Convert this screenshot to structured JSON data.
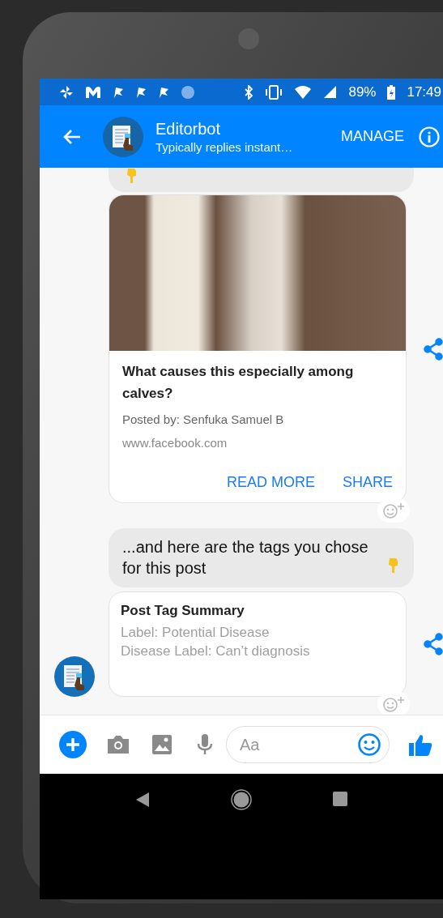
{
  "status_bar": {
    "battery": "89%",
    "time": "17:49"
  },
  "header": {
    "title": "Editorbot",
    "subtitle": "Typically replies instant…",
    "action": "MANAGE"
  },
  "messages": [
    {
      "kind": "emoji_tail"
    },
    {
      "kind": "link_card",
      "title": "What causes this especially among calves?",
      "posted_by": "Posted by: Senfuka Samuel B",
      "url": "www.facebook.com",
      "buttons": [
        "READ MORE",
        "SHARE"
      ]
    },
    {
      "kind": "text",
      "text": "...and here are the tags you chose for this post",
      "trailing_emoji": true
    },
    {
      "kind": "summary_card",
      "title": "Post Tag Summary",
      "lines": [
        "Label: Potential Disease",
        "Disease Label: Can’t diagnosis"
      ]
    }
  ],
  "composer": {
    "placeholder": "Aa"
  }
}
